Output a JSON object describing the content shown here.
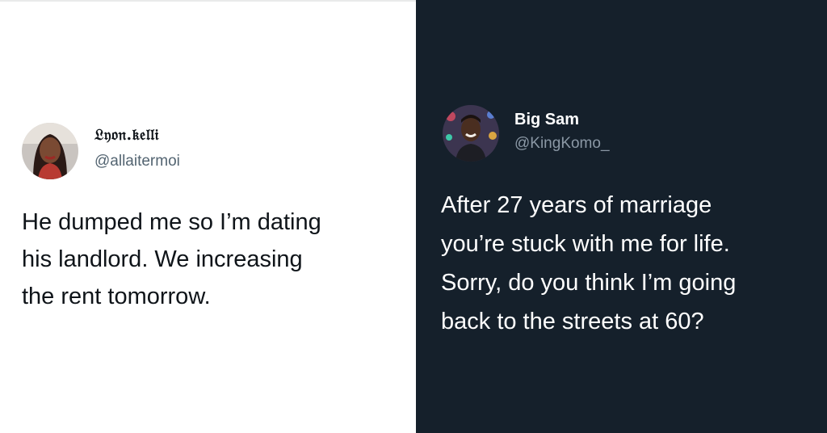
{
  "tweets": [
    {
      "display_name": "𝔏𝔶𝔬𝔫.𝔨𝔢𝔩𝔩𝔦",
      "handle": "@allaitermoi",
      "text_lines": [
        "He dumped me so I’m dating",
        "his landlord. We increasing",
        "the rent tomorrow."
      ],
      "theme": "light"
    },
    {
      "display_name": "Big Sam",
      "handle": "@KingKomo_",
      "text_lines": [
        "After 27 years of marriage",
        "you’re stuck with me for life.",
        "Sorry, do you think I’m going",
        "back to the streets at 60?"
      ],
      "theme": "dark"
    }
  ],
  "colors": {
    "light_bg": "#ffffff",
    "dark_bg": "#15202b",
    "light_text": "#0f1419",
    "light_handle": "#536471",
    "dark_text": "#ffffff",
    "dark_handle": "#8b98a5"
  }
}
